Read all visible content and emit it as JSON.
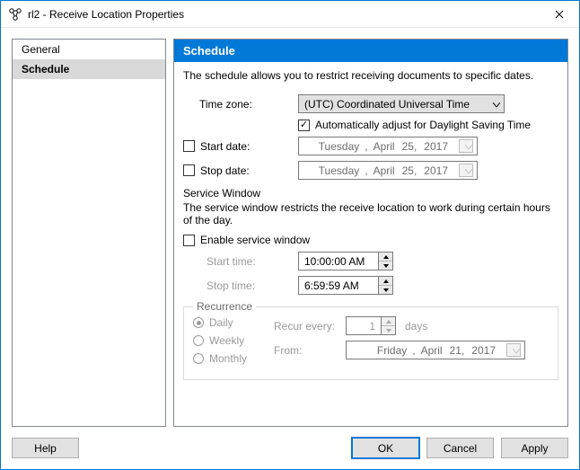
{
  "window": {
    "title": "rl2 - Receive Location Properties"
  },
  "sidebar": {
    "items": [
      {
        "label": "General"
      },
      {
        "label": "Schedule"
      }
    ],
    "selected_index": 1
  },
  "panel": {
    "header": "Schedule",
    "description": "The schedule allows you to restrict receiving documents to specific dates."
  },
  "timezone": {
    "label": "Time zone:",
    "value": "(UTC) Coordinated Universal Time",
    "auto_dst_label": "Automatically adjust for Daylight Saving Time",
    "auto_dst_checked": true
  },
  "start_date": {
    "label": "Start date:",
    "checked": false,
    "weekday": "Tuesday",
    "month": "April",
    "day": "25,",
    "year": "2017"
  },
  "stop_date": {
    "label": "Stop date:",
    "checked": false,
    "weekday": "Tuesday",
    "month": "April",
    "day": "25,",
    "year": "2017"
  },
  "service_window": {
    "title": "Service Window",
    "description": "The service window restricts the receive location to work during certain hours of the day.",
    "enable_label": "Enable service window",
    "enable_checked": false,
    "start_time_label": "Start time:",
    "start_time_value": "10:00:00 AM",
    "stop_time_label": "Stop time:",
    "stop_time_value": "6:59:59 AM"
  },
  "recurrence": {
    "legend": "Recurrence",
    "options": {
      "daily": "Daily",
      "weekly": "Weekly",
      "monthly": "Monthly"
    },
    "selected": "daily",
    "recur_label": "Recur every:",
    "recur_value": "1",
    "recur_unit": "days",
    "from_label": "From:",
    "from_weekday": "Friday",
    "from_month": "April",
    "from_day": "21,",
    "from_year": "2017"
  },
  "buttons": {
    "help": "Help",
    "ok": "OK",
    "cancel": "Cancel",
    "apply": "Apply"
  }
}
